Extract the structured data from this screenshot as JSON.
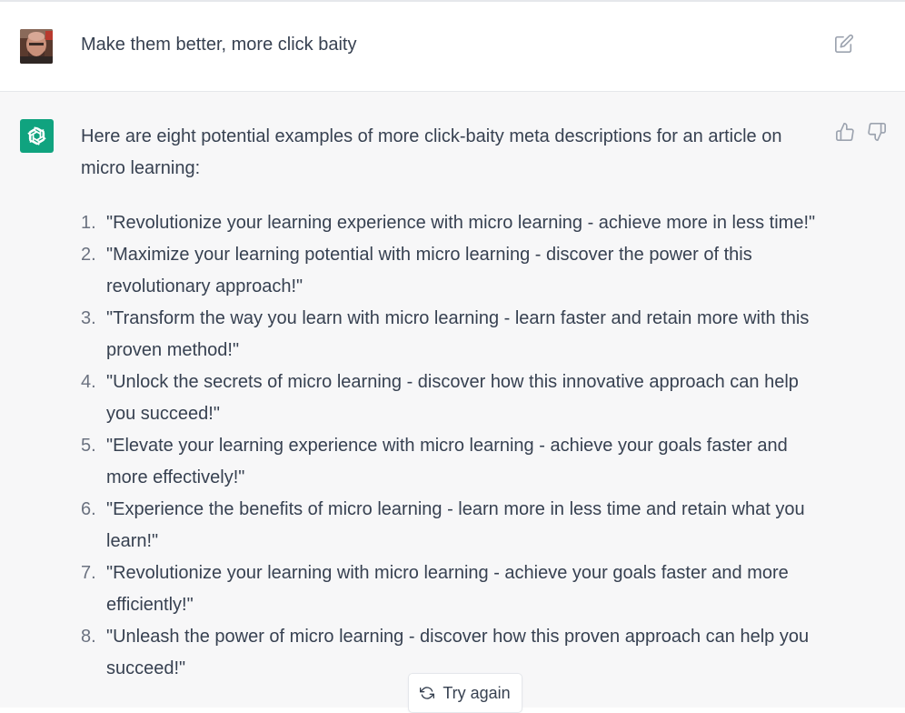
{
  "user_message": {
    "text": "Make them better, more click baity",
    "avatar": "user-photo-avatar"
  },
  "assistant_message": {
    "intro": "Here are eight potential examples of more click-baity meta descriptions for an article on micro learning:",
    "items": [
      {
        "num": "1.",
        "text": "\"Revolutionize your learning experience with micro learning - achieve more in less time!\""
      },
      {
        "num": "2.",
        "text": "\"Maximize your learning potential with micro learning - discover the power of this revolutionary approach!\""
      },
      {
        "num": "3.",
        "text": "\"Transform the way you learn with micro learning - learn faster and retain more with this proven method!\""
      },
      {
        "num": "4.",
        "text": "\"Unlock the secrets of micro learning - discover how this innovative approach can help you succeed!\""
      },
      {
        "num": "5.",
        "text": "\"Elevate your learning experience with micro learning - achieve your goals faster and more effectively!\""
      },
      {
        "num": "6.",
        "text": "\"Experience the benefits of micro learning - learn more in less time and retain what you learn!\""
      },
      {
        "num": "7.",
        "text": "\"Revolutionize your learning with micro learning - achieve your goals faster and more efficiently!\""
      },
      {
        "num": "8.",
        "text": "\"Unleash the power of micro learning - discover how this proven approach can help you succeed!\""
      }
    ]
  },
  "actions": {
    "try_again_label": "Try again"
  },
  "colors": {
    "brand_green": "#10a37f",
    "assistant_bg": "#f7f7f8",
    "text": "#374151"
  },
  "icons": [
    "edit-icon",
    "thumbs-up-icon",
    "thumbs-down-icon",
    "openai-logo-icon",
    "refresh-icon"
  ]
}
